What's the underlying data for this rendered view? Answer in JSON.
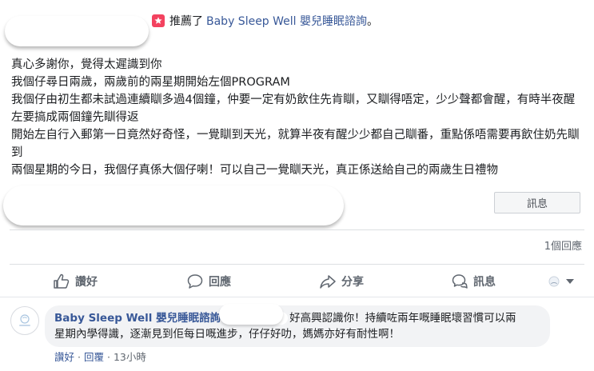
{
  "header": {
    "action_text": "推薦了",
    "page_name": "Baby Sleep Well 嬰兒睡眠諮詢",
    "suffix": "。",
    "icon": "recommend-flag-icon",
    "icon_color": "#f3425f"
  },
  "post": {
    "lines": [
      "真心多謝你，覺得太遲識到你",
      "我個仔尋日兩歲，兩歲前的兩星期開始左個PROGRAM",
      "我個仔由初生都未試過連續瞓多過4個鐘，仲要一定有奶飲住先肯瞓，又瞓得唔定，少少聲都會醒，有時半夜醒左要搞成兩個鐘先瞓得返",
      "開始左自行入郵第一日竟然好奇怪，一覺瞓到天光，就算半夜有醒少少都自己瞓番，重點係唔需要再飲住奶先瞓到",
      "兩個星期的今日，我個仔真係大個仔喇！可以自己一覺瞓天光，真正係送給自己的兩歲生日禮物"
    ]
  },
  "message_button": "訊息",
  "reply_count": "1個回應",
  "actions": {
    "like": "讚好",
    "comment": "回應",
    "share": "分享",
    "message": "訊息"
  },
  "comment": {
    "author": "Baby Sleep Well 嬰兒睡眠諮詢",
    "text_line1": "好高興認識你！持續咗兩年嘅睡眠壞習慣可以兩",
    "text_line2": "星期內學得識，逐漸見到佢每日嘅進步，仔仔好叻，媽媽亦好有耐性啊！",
    "like": "讚好",
    "separator": "·",
    "reply": "回覆",
    "time": "13小時"
  },
  "colors": {
    "link": "#385898",
    "meta": "#606770",
    "bubble": "#f2f3f5"
  }
}
